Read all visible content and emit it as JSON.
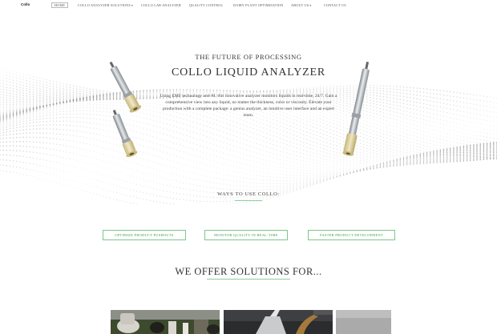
{
  "nav": {
    "logo": "Collo",
    "items": [
      {
        "label": "Home",
        "active": true
      },
      {
        "label": "Collo Analyzer Solutions",
        "has_dropdown": true
      },
      {
        "label": "Collo Lab Analyzer"
      },
      {
        "label": "Quality Control"
      },
      {
        "label": "Dairy Plant Optimisation"
      },
      {
        "label": "About Us",
        "has_dropdown": true
      },
      {
        "label": "Contact Us"
      }
    ],
    "caret": "▾"
  },
  "hero": {
    "eyebrow": "The Future of Processing",
    "title": "Collo Liquid Analyzer",
    "description": "Using EMF technology and AI, this innovative analyzer monitors liquids in real-time, 24/7. Gain a comprehensive view into any liquid, no matter the thickness, color or viscosity. Elevate your production with a complete package: a genius analyzer, an intuitive user interface and an expert team."
  },
  "ways": {
    "title": "Ways to use Collo:",
    "buttons": [
      {
        "label": "Optimize product pushouts"
      },
      {
        "label": "Monitor quality in real-time"
      },
      {
        "label": "Faster product development"
      }
    ]
  },
  "solutions": {
    "title": "We offer solutions for..."
  },
  "colors": {
    "accent_green": "#7fc68b",
    "accent_green_text": "#3c9a52",
    "probe_steel": "#b8bdc2",
    "probe_beige": "#e3d6a4"
  }
}
